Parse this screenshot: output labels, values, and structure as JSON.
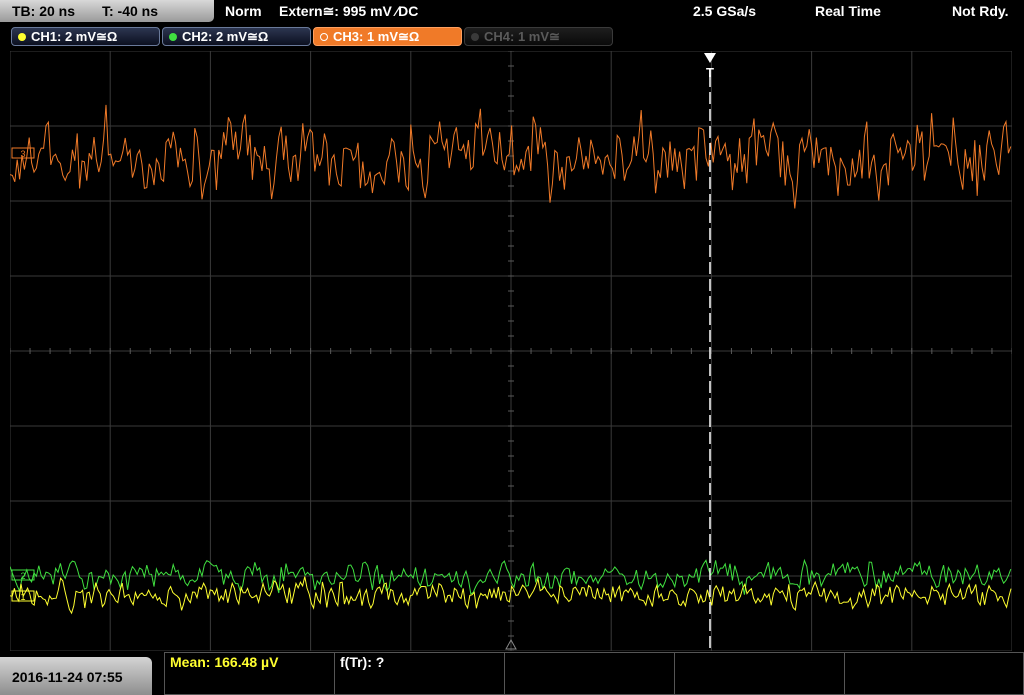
{
  "timebase": {
    "tb": "TB: 20 ns",
    "trigger_time": "T: -40 ns"
  },
  "status": {
    "mode": "Norm",
    "trigger": "Extern≅: 995 mV ∕DC",
    "sample_rate": "2.5 GSa/s",
    "acquisition": "Real Time",
    "state": "Not Rdy."
  },
  "channels": [
    {
      "label": "CH1: 2 mV≅Ω",
      "color": "#ffff30",
      "state": "on"
    },
    {
      "label": "CH2: 2 mV≅Ω",
      "color": "#40e040",
      "state": "on"
    },
    {
      "label": "CH3: 1 mV≅Ω",
      "color": "#f07a28",
      "state": "selected"
    },
    {
      "label": "CH4: 1 mV≅",
      "color": "#555555",
      "state": "off"
    }
  ],
  "markers": {
    "trigger_label": "T",
    "ch1_ref": "1",
    "ch2_ref": "2",
    "ch3_ref": "3"
  },
  "bottom": {
    "datetime": "2016-11-24  07:55",
    "mean": "Mean: 166.48 µV",
    "freq": "f(Tr): ?"
  },
  "colors": {
    "ch1": "#ffff30",
    "ch2": "#40e040",
    "ch3": "#f07a28",
    "grid": "#3c3c3c"
  }
}
